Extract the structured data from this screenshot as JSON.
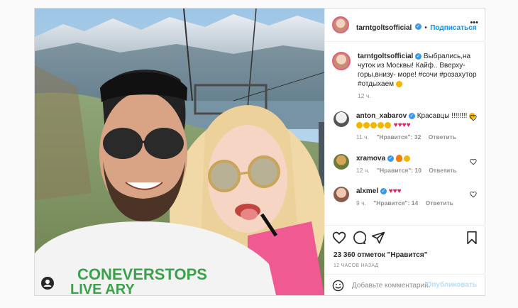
{
  "post": {
    "author": "tarntgoltsofficial",
    "follow_label": "Подписаться",
    "dot": "•",
    "more_glyph": "•••",
    "caption": "Выбрались,на чуток из Москвы! Кайф.. Вверху- горы,внизу- море! #сочи #розахутор #отдыхаем",
    "caption_time": "12 ч.",
    "likes": "23 360 отметок \"Нравится\"",
    "posted": "12 ЧАСОВ НАЗАД",
    "comment_placeholder": "Добавьте комментарий...",
    "publish_label": "Опубликовать"
  },
  "comments": [
    {
      "user": "anton_xabarov",
      "verified": true,
      "text": "Красавцы !!!!!!!!",
      "time": "11 ч.",
      "likes": "\"Нравится\": 32",
      "reply": "Ответить"
    },
    {
      "user": "xramova",
      "verified": true,
      "text": "",
      "time": "12 ч.",
      "likes": "\"Нравится\": 10",
      "reply": "Ответить"
    },
    {
      "user": "alxmel",
      "verified": true,
      "text": "",
      "time": "9 ч.",
      "likes": "\"Нравится\": 14",
      "reply": "Ответить"
    }
  ],
  "colors": {
    "accent": "#0095f6",
    "verified": "#3897f0",
    "heart": "#e0245e"
  },
  "icons": [
    "more-options-icon",
    "heart-icon",
    "comment-icon",
    "share-icon",
    "bookmark-icon",
    "emoji-icon",
    "user-tag-icon"
  ]
}
